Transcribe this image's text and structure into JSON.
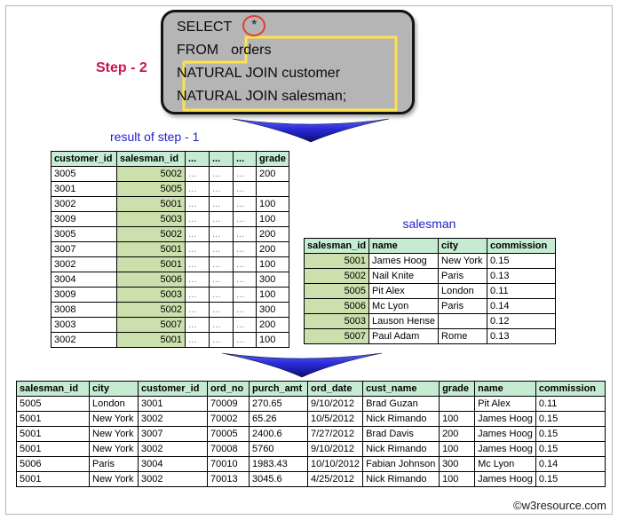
{
  "labels": {
    "step": "Step - 2",
    "result_of_step_1": "result of step - 1",
    "salesman_table_title": "salesman",
    "watermark": "©w3resource.com"
  },
  "query": {
    "select_keyword": "SELECT",
    "star": "*",
    "from_keyword": "FROM",
    "from_table": "orders",
    "join_line_1": "NATURAL JOIN customer",
    "join_line_2": "NATURAL JOIN salesman;"
  },
  "colors": {
    "step_label": "#c81653",
    "blue_label": "#1f1fcd",
    "table_header_bg": "#c5ecd2",
    "key_column_bg": "#cbe0ad",
    "query_box_bg": "#b5b5b5",
    "highlight_outline": "#ffe24a",
    "star_circle": "#e53b32",
    "arrow_top": "#5560f0",
    "arrow_mid": "#2a2ad8",
    "arrow_bottom": "#0d0d6e"
  },
  "tables": {
    "step1_result": {
      "columns": [
        "customer_id",
        "salesman_id",
        "...",
        "...",
        "...",
        "grade"
      ],
      "rows": [
        [
          "3005",
          "5002",
          "...",
          "...",
          "...",
          "200"
        ],
        [
          "3001",
          "5005",
          "...",
          "...",
          "...",
          ""
        ],
        [
          "3002",
          "5001",
          "...",
          "...",
          "...",
          "100"
        ],
        [
          "3009",
          "5003",
          "...",
          "...",
          "...",
          "100"
        ],
        [
          "3005",
          "5002",
          "...",
          "...",
          "...",
          "200"
        ],
        [
          "3007",
          "5001",
          "...",
          "...",
          "...",
          "200"
        ],
        [
          "3002",
          "5001",
          "...",
          "...",
          "...",
          "100"
        ],
        [
          "3004",
          "5006",
          "...",
          "...",
          "...",
          "300"
        ],
        [
          "3009",
          "5003",
          "...",
          "...",
          "...",
          "100"
        ],
        [
          "3008",
          "5002",
          "...",
          "...",
          "...",
          "300"
        ],
        [
          "3003",
          "5007",
          "...",
          "...",
          "...",
          "200"
        ],
        [
          "3002",
          "5001",
          "...",
          "...",
          "...",
          "100"
        ]
      ]
    },
    "salesman": {
      "columns": [
        "salesman_id",
        "name",
        "city",
        "commission"
      ],
      "rows": [
        [
          "5001",
          "James Hoog",
          "New York",
          "0.15"
        ],
        [
          "5002",
          "Nail Knite",
          "Paris",
          "0.13"
        ],
        [
          "5005",
          "Pit Alex",
          "London",
          "0.11"
        ],
        [
          "5006",
          "Mc Lyon",
          "Paris",
          "0.14"
        ],
        [
          "5003",
          "Lauson Hense",
          "",
          "0.12"
        ],
        [
          "5007",
          "Paul Adam",
          "Rome",
          "0.13"
        ]
      ]
    },
    "final_result": {
      "columns": [
        "salesman_id",
        "city",
        "customer_id",
        "ord_no",
        "purch_amt",
        "ord_date",
        "cust_name",
        "grade",
        "name",
        "commission"
      ],
      "rows": [
        [
          "5005",
          "London",
          "3001",
          "70009",
          "270.65",
          "9/10/2012",
          "Brad Guzan",
          "",
          "Pit Alex",
          "0.11"
        ],
        [
          "5001",
          "New York",
          "3002",
          "70002",
          "65.26",
          "10/5/2012",
          "Nick Rimando",
          "100",
          "James Hoog",
          "0.15"
        ],
        [
          "5001",
          "New York",
          "3007",
          "70005",
          "2400.6",
          "7/27/2012",
          "Brad Davis",
          "200",
          "James Hoog",
          "0.15"
        ],
        [
          "5001",
          "New York",
          "3002",
          "70008",
          "5760",
          "9/10/2012",
          "Nick Rimando",
          "100",
          "James Hoog",
          "0.15"
        ],
        [
          "5006",
          "Paris",
          "3004",
          "70010",
          "1983.43",
          "10/10/2012",
          "Fabian Johnson",
          "300",
          "Mc Lyon",
          "0.14"
        ],
        [
          "5001",
          "New York",
          "3002",
          "70013",
          "3045.6",
          "4/25/2012",
          "Nick Rimando",
          "100",
          "James Hoog",
          "0.15"
        ]
      ]
    }
  }
}
